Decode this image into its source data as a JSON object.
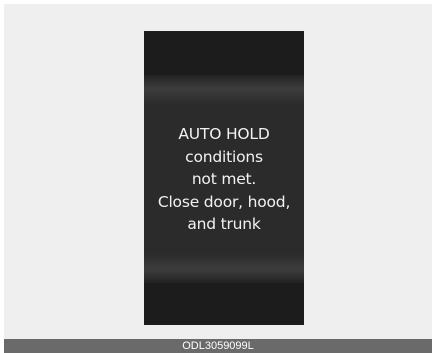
{
  "display": {
    "message_lines": [
      "AUTO HOLD",
      "conditions",
      "not met.",
      "Close door, hood,",
      "and trunk"
    ]
  },
  "caption": {
    "code": "ODL3059099L"
  }
}
